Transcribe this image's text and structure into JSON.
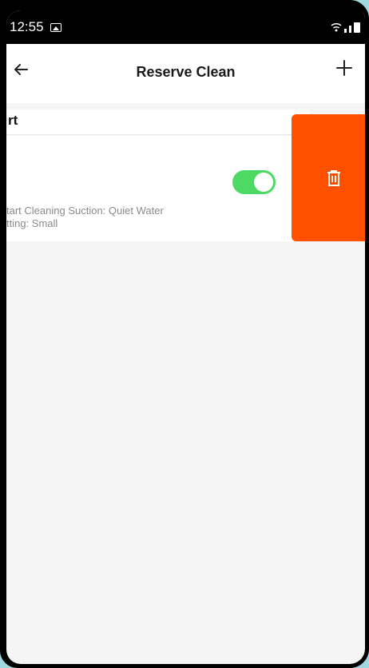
{
  "status_bar": {
    "time": "12:55"
  },
  "header": {
    "title": "Reserve Clean"
  },
  "section": {
    "label": "rt"
  },
  "schedule": {
    "enabled": true,
    "description_line1": "tart Cleaning  Suction: Quiet  Water",
    "description_line2": "tting: Small"
  },
  "colors": {
    "accent_green": "#4cd964",
    "delete_orange": "#ff5000"
  },
  "icons": [
    "back-arrow-icon",
    "plus-icon",
    "trash-icon",
    "gallery-icon",
    "wifi-icon",
    "signal-icon",
    "battery-icon"
  ]
}
